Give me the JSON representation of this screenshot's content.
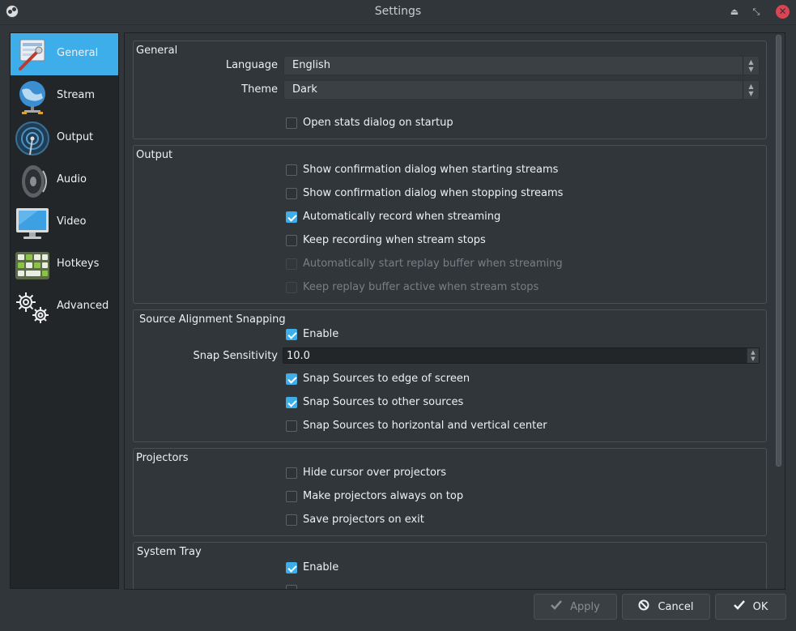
{
  "window": {
    "title": "Settings",
    "shade_glyph": "⏏",
    "restore_glyph": "⤡",
    "close_glyph": "✕"
  },
  "sidebar": {
    "items": [
      {
        "label": "General",
        "icon": "general-settings-icon",
        "active": true
      },
      {
        "label": "Stream",
        "icon": "stream-globe-icon",
        "active": false
      },
      {
        "label": "Output",
        "icon": "output-antenna-icon",
        "active": false
      },
      {
        "label": "Audio",
        "icon": "audio-speaker-icon",
        "active": false
      },
      {
        "label": "Video",
        "icon": "video-monitor-icon",
        "active": false
      },
      {
        "label": "Hotkeys",
        "icon": "hotkeys-keyboard-icon",
        "active": false
      },
      {
        "label": "Advanced",
        "icon": "advanced-gears-icon",
        "active": false
      }
    ]
  },
  "general": {
    "title": "General",
    "language_label": "Language",
    "language_value": "English",
    "theme_label": "Theme",
    "theme_value": "Dark",
    "stats_label": "Open stats dialog on startup",
    "stats_checked": false
  },
  "output": {
    "title": "Output",
    "options": [
      {
        "label": "Show confirmation dialog when starting streams",
        "checked": false,
        "disabled": false
      },
      {
        "label": "Show confirmation dialog when stopping streams",
        "checked": false,
        "disabled": false
      },
      {
        "label": "Automatically record when streaming",
        "checked": true,
        "disabled": false
      },
      {
        "label": "Keep recording when stream stops",
        "checked": false,
        "disabled": false
      },
      {
        "label": "Automatically start replay buffer when streaming",
        "checked": false,
        "disabled": true
      },
      {
        "label": "Keep replay buffer active when stream stops",
        "checked": false,
        "disabled": true
      }
    ]
  },
  "snapping": {
    "title": "Source Alignment Snapping",
    "enable_label": "Enable",
    "enable_checked": true,
    "sensitivity_label": "Snap Sensitivity",
    "sensitivity_value": "10.0",
    "options": [
      {
        "label": "Snap Sources to edge of screen",
        "checked": true
      },
      {
        "label": "Snap Sources to other sources",
        "checked": true
      },
      {
        "label": "Snap Sources to horizontal and vertical center",
        "checked": false
      }
    ]
  },
  "projectors": {
    "title": "Projectors",
    "options": [
      {
        "label": "Hide cursor over projectors",
        "checked": false
      },
      {
        "label": "Make projectors always on top",
        "checked": false
      },
      {
        "label": "Save projectors on exit",
        "checked": false
      }
    ]
  },
  "systray": {
    "title": "System Tray",
    "enable_label": "Enable",
    "enable_checked": true
  },
  "buttons": {
    "apply": "Apply",
    "cancel": "Cancel",
    "ok": "OK"
  },
  "colors": {
    "accent": "#3daee9",
    "background": "#31363b",
    "sidebar": "#232629",
    "close": "#da4453"
  }
}
